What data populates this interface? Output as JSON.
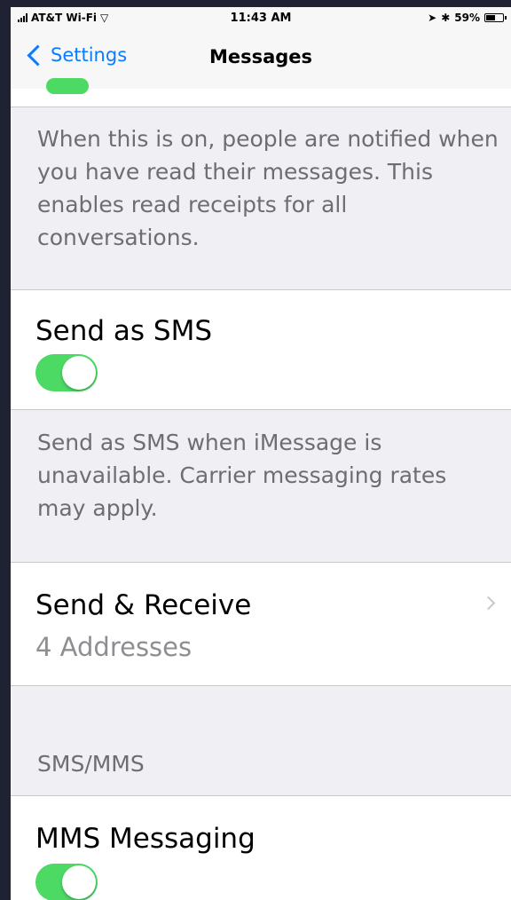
{
  "status_bar": {
    "carrier": "AT&T Wi-Fi",
    "time": "11:43 AM",
    "battery": "59%",
    "battery_fraction": 0.59
  },
  "nav": {
    "back_label": "Settings",
    "title": "Messages"
  },
  "read_receipts": {
    "footer": "When this is on, people are notified when you have read their messages. This enables read receipts for all conversations."
  },
  "send_as_sms": {
    "label": "Send as SMS",
    "enabled": true,
    "footer": "Send as SMS when iMessage is unavailable. Carrier messaging rates may apply."
  },
  "send_receive": {
    "label": "Send & Receive",
    "detail": "4 Addresses"
  },
  "sms_mms_section": {
    "header": "SMS/MMS"
  },
  "mms_messaging": {
    "label": "MMS Messaging",
    "enabled": true
  },
  "colors": {
    "accent": "#0a7cff",
    "toggle_on": "#4cd964",
    "background": "#efeff4"
  }
}
